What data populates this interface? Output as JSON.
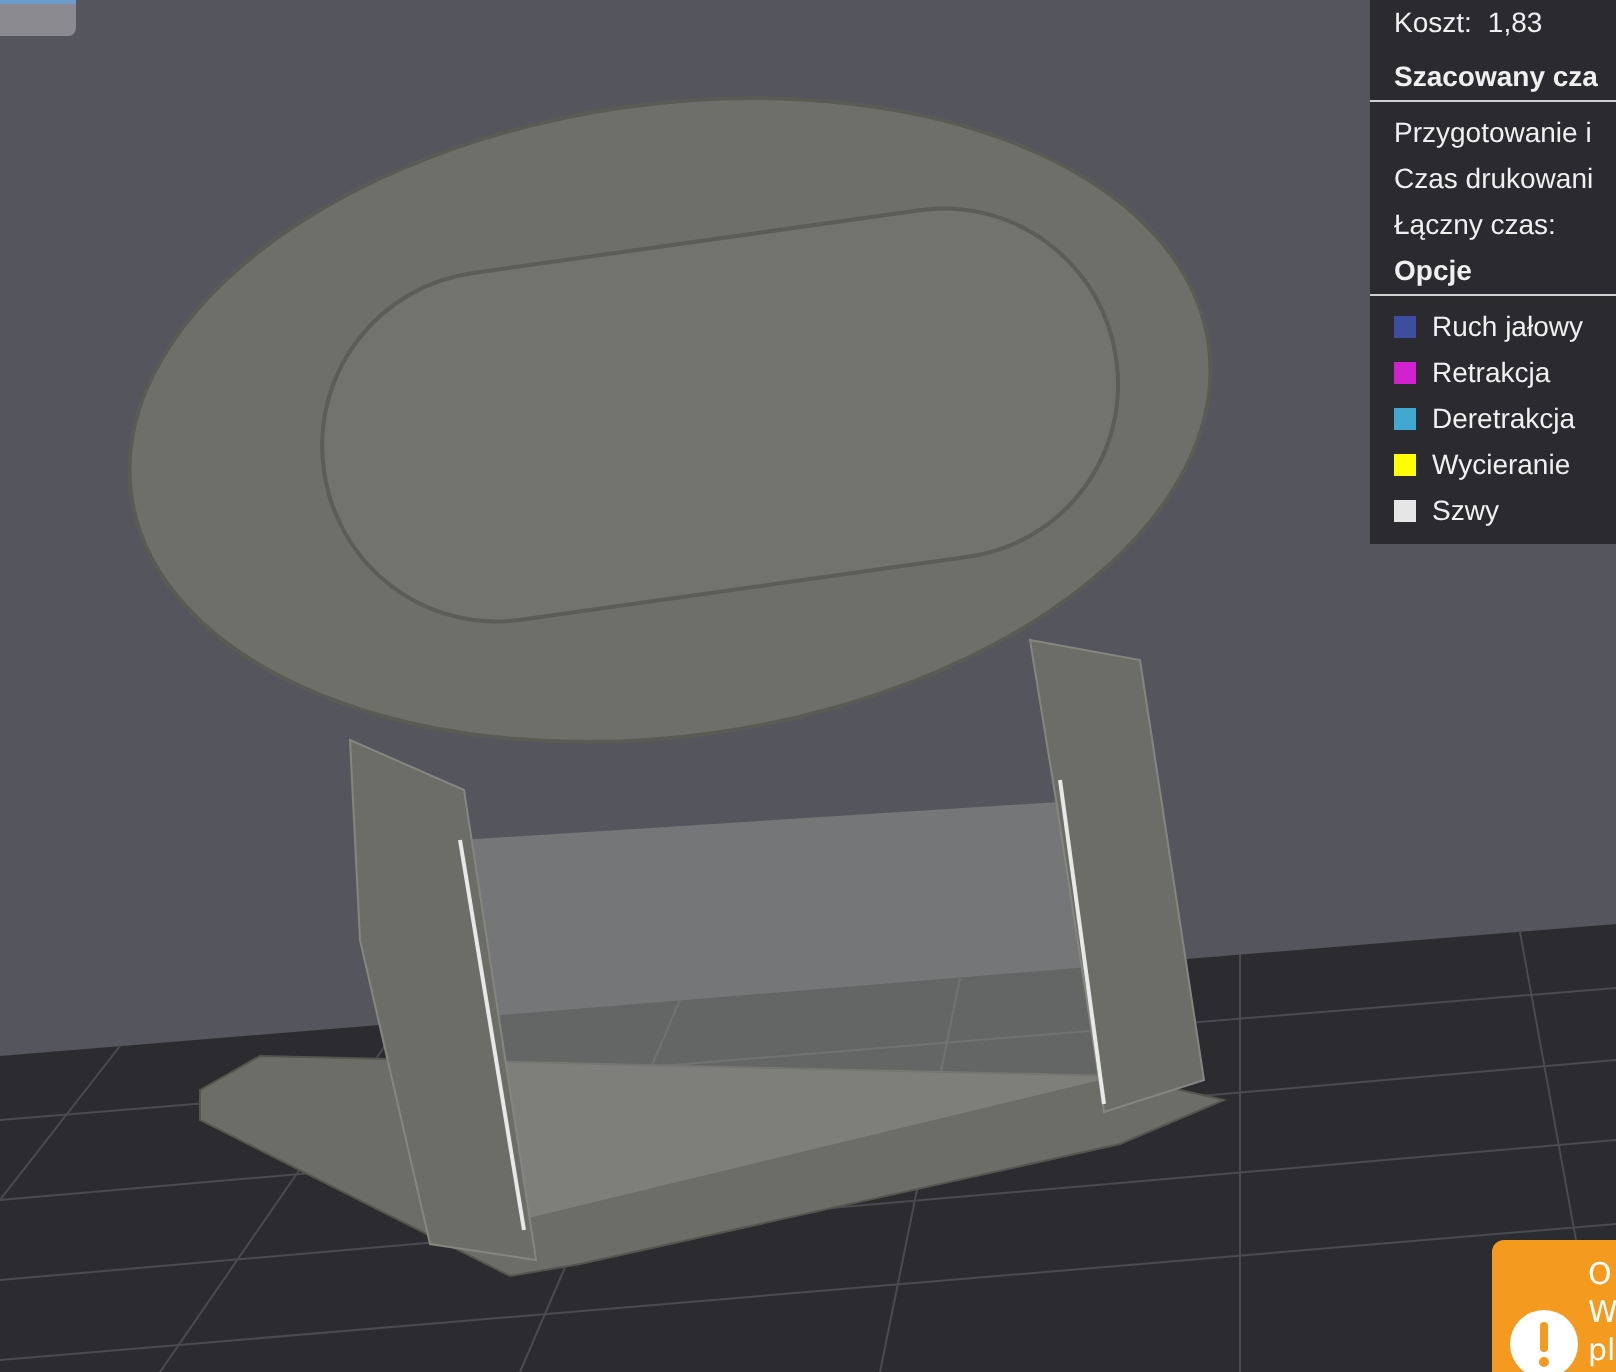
{
  "legend": {
    "cost_label": "Koszt:",
    "cost_value": "1,83",
    "time_header": "Szacowany cza",
    "time_rows": [
      "Przygotowanie i",
      "Czas drukowani",
      "Łączny czas:"
    ],
    "options_header": "Opcje",
    "options": [
      {
        "label": "Ruch jałowy",
        "color": "#3d4da0"
      },
      {
        "label": "Retrakcja",
        "color": "#d020d0"
      },
      {
        "label": "Deretrakcja",
        "color": "#40a8d0"
      },
      {
        "label": "Wycieranie",
        "color": "#ffff00"
      },
      {
        "label": "Szwy",
        "color": "#e6e6e6"
      }
    ]
  },
  "notification": {
    "lines": [
      "O",
      "W",
      "pl"
    ]
  }
}
